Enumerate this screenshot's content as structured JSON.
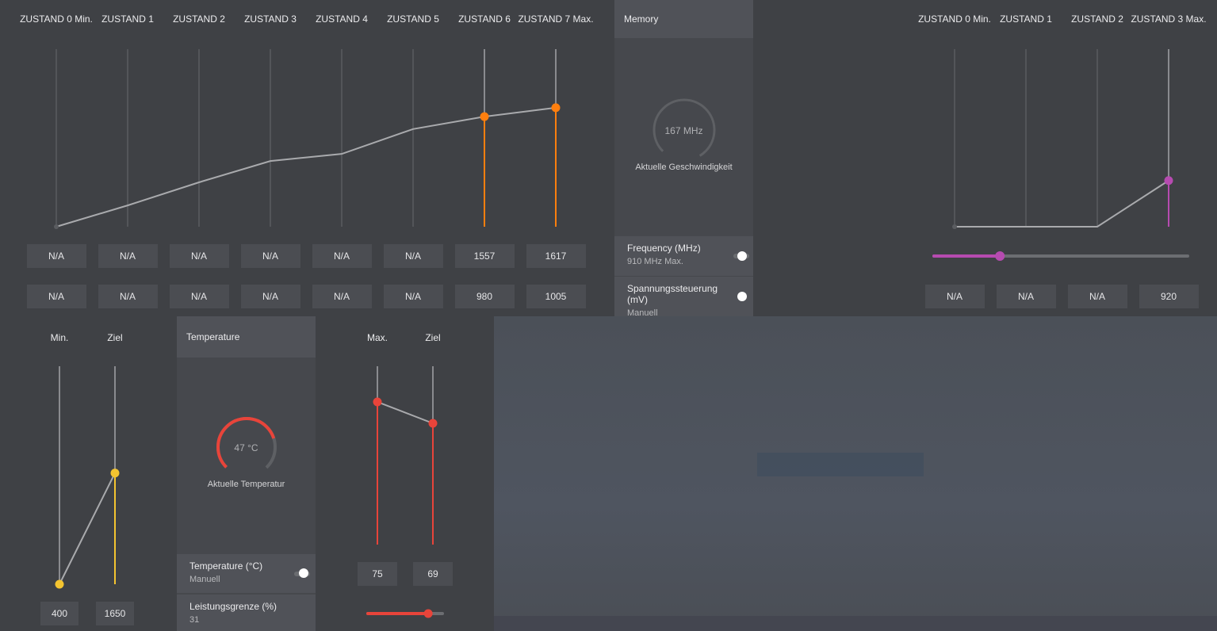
{
  "gpu_states": {
    "headers": [
      "ZUSTAND 0 Min.",
      "ZUSTAND 1",
      "ZUSTAND 2",
      "ZUSTAND 3",
      "ZUSTAND 4",
      "ZUSTAND 5",
      "ZUSTAND 6",
      "ZUSTAND 7 Max."
    ],
    "frequency": [
      "N/A",
      "N/A",
      "N/A",
      "N/A",
      "N/A",
      "N/A",
      "1557",
      "1617"
    ],
    "voltage": [
      "N/A",
      "N/A",
      "N/A",
      "N/A",
      "N/A",
      "N/A",
      "980",
      "1005"
    ],
    "curve_levels": [
      0.0,
      0.12,
      0.25,
      0.37,
      0.41,
      0.55,
      0.62,
      0.67
    ],
    "active_color": "#ff7f0e"
  },
  "memory": {
    "tab_label": "Memory",
    "gauge_value": "167 MHz",
    "gauge_label": "Aktuelle Geschwindigkeit",
    "frequency_title": "Frequency (MHz)",
    "frequency_sub": "910 MHz Max.",
    "voltage_title": "Spannungssteuerung (mV)",
    "voltage_sub": "Manuell",
    "headers": [
      "ZUSTAND 0 Min.",
      "ZUSTAND 1",
      "ZUSTAND 2",
      "ZUSTAND 3 Max."
    ],
    "voltage_values": [
      "N/A",
      "N/A",
      "N/A",
      "920"
    ],
    "curve_levels": [
      0.0,
      0.0,
      0.0,
      0.26
    ],
    "slider_level": 0.26,
    "accent": "#b64bb0"
  },
  "fan": {
    "headers": [
      "Min.",
      "Ziel"
    ],
    "values": [
      "400",
      "1650"
    ],
    "levels": [
      0.0,
      0.51
    ],
    "accent": "#f4c430"
  },
  "temperature": {
    "tab_label": "Temperature",
    "gauge_value": "47 °C",
    "gauge_label": "Aktuelle Temperatur",
    "temp_title": "Temperature (°C)",
    "temp_sub": "Manuell",
    "power_title": "Leistungsgrenze (%)",
    "power_sub": "31",
    "headers": [
      "Max.",
      "Ziel"
    ],
    "values": [
      "75",
      "69"
    ],
    "levels": [
      0.8,
      0.68
    ],
    "power_slider_level": 0.81,
    "accent": "#e8443a"
  }
}
